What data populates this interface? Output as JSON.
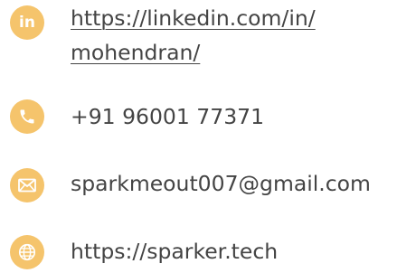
{
  "contacts": {
    "linkedin": {
      "icon": "linkedin-icon",
      "icon_glyph": "in",
      "line1": "https://linkedin.com/in/",
      "line2": "mohendran/"
    },
    "phone": {
      "icon": "phone-icon",
      "value": "+91 96001 77371"
    },
    "email": {
      "icon": "mail-icon",
      "value": "sparkmeout007@gmail.com"
    },
    "website": {
      "icon": "globe-icon",
      "value": "https://sparker.tech"
    }
  },
  "colors": {
    "icon_background": "#f5c46c",
    "icon_foreground": "#ffffff",
    "text": "#444444"
  }
}
